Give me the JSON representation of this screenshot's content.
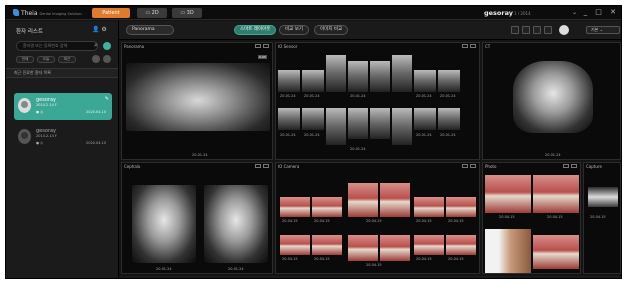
{
  "app": {
    "logo": "Theia",
    "logo_sub": "Dental Imaging Solution"
  },
  "top_tabs": [
    {
      "label": "Patient"
    },
    {
      "label": "2D"
    },
    {
      "label": "3D"
    }
  ],
  "patient_header": {
    "name": "gesoray",
    "date": "1 / 2014",
    "chevron": "⌄"
  },
  "window_controls": "_ □ ✕",
  "left_panel": {
    "title": "환자 리스트",
    "search_placeholder": "환자명 또는 등록번호 검색",
    "filters": [
      "전체",
      "오늘",
      "최근"
    ],
    "section_title": "최근 진료한 환자 목록",
    "patients": [
      {
        "name": "gesoray",
        "info": "2014.2.14 F",
        "meta": "● ◎",
        "date": "2020.04.10",
        "active": true
      },
      {
        "name": "gesoray",
        "info": "2014.2.14 F",
        "meta": "● ◎",
        "date": "2020.04.10",
        "active": false
      }
    ]
  },
  "toolbar": {
    "pill": "Panorama",
    "buttons": [
      "스마트 레이아웃",
      "비교 보기",
      "이미지 비교"
    ],
    "dropdown": "기본"
  },
  "panels": {
    "panorama": {
      "title": "Panorama",
      "timestamp": "20.01.24",
      "tag": "0.03"
    },
    "io_sensor": {
      "title": "IO Sensor",
      "timestamps": [
        "20.01.24",
        "20.01.24",
        "20.01.24",
        "20.01.24",
        "20.01.24",
        "20.01.24",
        "20.01.24",
        "20.01.24",
        "20.01.24",
        "20.01.24"
      ]
    },
    "ct": {
      "title": "CT",
      "timestamp": "20.01.24"
    },
    "cephalo": {
      "title": "Cephalo",
      "timestamps": [
        "20.01.24",
        "20.01.24"
      ]
    },
    "io_camera": {
      "title": "IO Camera",
      "timestamps": [
        "20.04.15",
        "20.04.15",
        "20.04.15",
        "20.04.15",
        "20.04.15",
        "20.04.15",
        "20.04.15",
        "20.04.15",
        "20.04.15",
        "20.04.15"
      ]
    },
    "photo": {
      "title": "Photo",
      "timestamps": [
        "20.04.15",
        "20.04.15"
      ]
    },
    "capture": {
      "title": "Capture",
      "timestamp": "20.04.15"
    }
  }
}
